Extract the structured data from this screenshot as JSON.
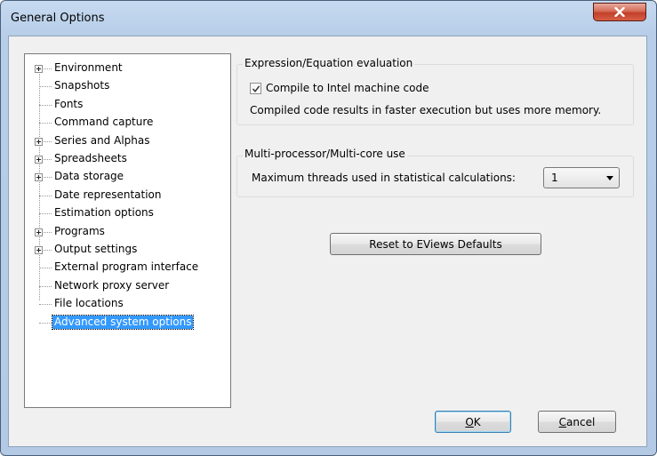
{
  "window": {
    "title": "General Options"
  },
  "tree": {
    "items": [
      {
        "label": "Environment",
        "expandable": true
      },
      {
        "label": "Snapshots",
        "expandable": false
      },
      {
        "label": "Fonts",
        "expandable": false
      },
      {
        "label": "Command capture",
        "expandable": false
      },
      {
        "label": "Series and Alphas",
        "expandable": true
      },
      {
        "label": "Spreadsheets",
        "expandable": true
      },
      {
        "label": "Data storage",
        "expandable": true
      },
      {
        "label": "Date representation",
        "expandable": false
      },
      {
        "label": "Estimation options",
        "expandable": false
      },
      {
        "label": "Programs",
        "expandable": true
      },
      {
        "label": "Output settings",
        "expandable": true
      },
      {
        "label": "External program interface",
        "expandable": false
      },
      {
        "label": "Network proxy server",
        "expandable": false
      },
      {
        "label": "File locations",
        "expandable": false
      },
      {
        "label": "Advanced system options",
        "expandable": false,
        "selected": true
      }
    ]
  },
  "expression_group": {
    "title": "Expression/Equation evaluation",
    "compile_label": "Compile to Intel machine code",
    "compile_checked": true,
    "note": "Compiled code results in faster execution but uses more memory."
  },
  "multicore_group": {
    "title": "Multi-processor/Multi-core use",
    "threads_label": "Maximum threads used in statistical calculations:",
    "threads_value": "1"
  },
  "buttons": {
    "reset": "Reset to EViews Defaults",
    "ok": "OK",
    "cancel": "Cancel"
  },
  "colors": {
    "selection": "#3399ff",
    "close": "#c2402a",
    "frame": "#b7cde8"
  }
}
